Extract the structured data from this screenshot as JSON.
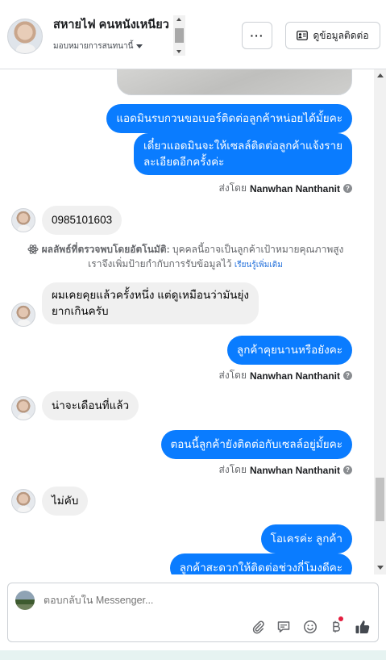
{
  "header": {
    "contact_name": "สหายไฟ คนหนังเหนียว",
    "assign_label": "มอบหมายการสนทนานี้",
    "more_label": "···",
    "contact_info_label": "ดูข้อมูลติดต่อ"
  },
  "messages": [
    {
      "type": "out",
      "text": "แอดมินรบกวนขอเบอร์ติดต่อลูกค้าหน่อยได้มั้ยคะ"
    },
    {
      "type": "out",
      "text_lines": [
        "เดี๋ยวแอดมินจะให้เซลล์ติดต่อลูกค้าแจ้งราย",
        "ละเอียดอีกครั้งค่ะ"
      ]
    },
    {
      "type": "sent_by",
      "prefix": "ส่งโดย",
      "name": "Nanwhan Nanthanit"
    },
    {
      "type": "in",
      "text": "0985101603"
    },
    {
      "type": "system",
      "title": "ผลลัพธ์ที่ตรวจพบโดยอัตโนมัติ:",
      "body1": "บุคคลนี้อาจเป็นลูกค้าเป้าหมายคุณภาพสูง",
      "body2": "เราจึงเพิ่มป้ายกำกับการรับข้อมูลไว้",
      "link": "เรียนรู้เพิ่มเติม"
    },
    {
      "type": "in",
      "text_lines": [
        "ผมเคยคุยแล้วครั้งหนึ่ง แต่ดูเหมือนว่ามันยุ่ง",
        "ยากเกินครับ"
      ]
    },
    {
      "type": "out",
      "text": "ลูกค้าคุยนานหรือยังคะ"
    },
    {
      "type": "sent_by",
      "prefix": "ส่งโดย",
      "name": "Nanwhan Nanthanit"
    },
    {
      "type": "in",
      "text": "น่าจะเดือนที่แล้ว"
    },
    {
      "type": "out",
      "text": "ตอนนี้ลูกค้ายังติดต่อกับเซลล์อยู่มั้ยคะ"
    },
    {
      "type": "sent_by",
      "prefix": "ส่งโดย",
      "name": "Nanwhan Nanthanit"
    },
    {
      "type": "in",
      "text": "ไม่คับ"
    },
    {
      "type": "out",
      "text": "โอเครค่ะ ลูกค้า"
    },
    {
      "type": "out",
      "text": "ลูกค้าสะดวกให้ติดต่อช่วงกี่โมงดีคะ"
    }
  ],
  "composer": {
    "placeholder": "ตอบกลับใน Messenger...",
    "tools": [
      "paperclip-icon",
      "saved-reply-icon",
      "emoji-icon",
      "payment-icon",
      "like-icon"
    ]
  },
  "colors": {
    "outgoing_bubble": "#0a7cff",
    "incoming_bubble": "#f0f0f0",
    "link": "#216fdb",
    "notification_dot": "#e41e3f"
  }
}
